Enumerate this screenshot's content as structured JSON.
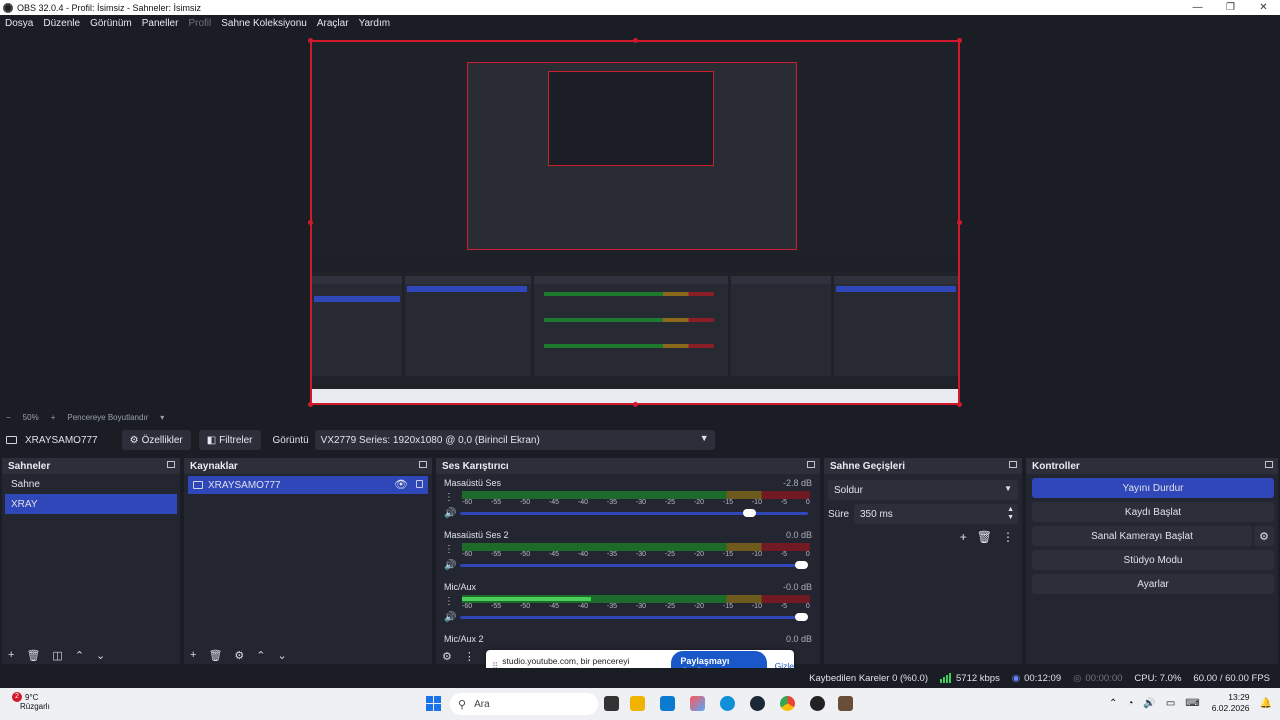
{
  "window": {
    "title": "OBS 32.0.4 - Profil: İsimsiz - Sahneler: İsimsiz",
    "controls": [
      "—",
      "❐",
      "✕"
    ]
  },
  "menu": [
    "Dosya",
    "Düzenle",
    "Görünüm",
    "Paneller",
    "Profil",
    "Sahne Koleksiyonu",
    "Araçlar",
    "Yardım"
  ],
  "menu_disabled": [
    "Profil"
  ],
  "zoom": {
    "minus": "−",
    "level": "50%",
    "plus": "+",
    "fit_label": "Pencereye Boyutlandır",
    "dropdown": "▾"
  },
  "source_toolbar": {
    "source_name": "XRAYSAMO777",
    "properties_label": "Özellikler",
    "filters_label": "Filtreler",
    "display_label": "Görüntü",
    "display_value": "VX2779 Series: 1920x1080 @ 0,0 (Birincil Ekran)"
  },
  "scenes": {
    "title": "Sahneler",
    "items": [
      "Sahne",
      "XRAY"
    ],
    "selected": "XRAY"
  },
  "sources": {
    "title": "Kaynaklar",
    "items": [
      "XRAYSAMO777"
    ]
  },
  "mixer": {
    "title": "Ses Karıştırıcı",
    "ticks": [
      "-60",
      "-55",
      "-50",
      "-45",
      "-40",
      "-35",
      "-30",
      "-25",
      "-20",
      "-15",
      "-10",
      "-5",
      "0"
    ],
    "channels": [
      {
        "name": "Masaüstü Ses",
        "db": "-2.8 dB",
        "volume": 0.85,
        "level": 0.0
      },
      {
        "name": "Masaüstü Ses 2",
        "db": "0.0 dB",
        "volume": 1.0,
        "level": 0.0
      },
      {
        "name": "Mic/Aux",
        "db": "-0.0 dB",
        "volume": 1.0,
        "level": 0.37
      },
      {
        "name": "Mic/Aux 2",
        "db": "0.0 dB",
        "volume": 1.0,
        "level": 0.0
      }
    ]
  },
  "transitions": {
    "title": "Sahne Geçişleri",
    "selected": "Soldur",
    "duration_label": "Süre",
    "duration_value": "350 ms"
  },
  "controls": {
    "title": "Kontroller",
    "stop_stream": "Yayını Durdur",
    "start_recording": "Kaydı Başlat",
    "start_virtual_cam": "Sanal Kamerayı Başlat",
    "studio_mode": "Stüdyo Modu",
    "settings": "Ayarlar"
  },
  "share_notification": {
    "text": "studio.youtube.com, bir pencereyi paylaşıyor.",
    "stop_label": "Paylaşmayı durdur",
    "hide_label": "Gizle"
  },
  "status": {
    "dropped_frames": "Kaybedilen Kareler 0 (%0.0)",
    "bitrate": "5712 kbps",
    "stream_time": "00:12:09",
    "record_time": "00:00:00",
    "cpu": "CPU: 7.0%",
    "fps": "60.00 / 60.00 FPS"
  },
  "taskbar": {
    "temperature": "9°C",
    "weather": "Rüzgarlı",
    "notification_count": "2",
    "search_placeholder": "Ara",
    "time": "13:29",
    "date": "6.02.2026"
  },
  "colors": {
    "accent": "#2f47b8",
    "recording_red": "#d2192c",
    "panel": "#232530",
    "background": "#1b1d24"
  }
}
